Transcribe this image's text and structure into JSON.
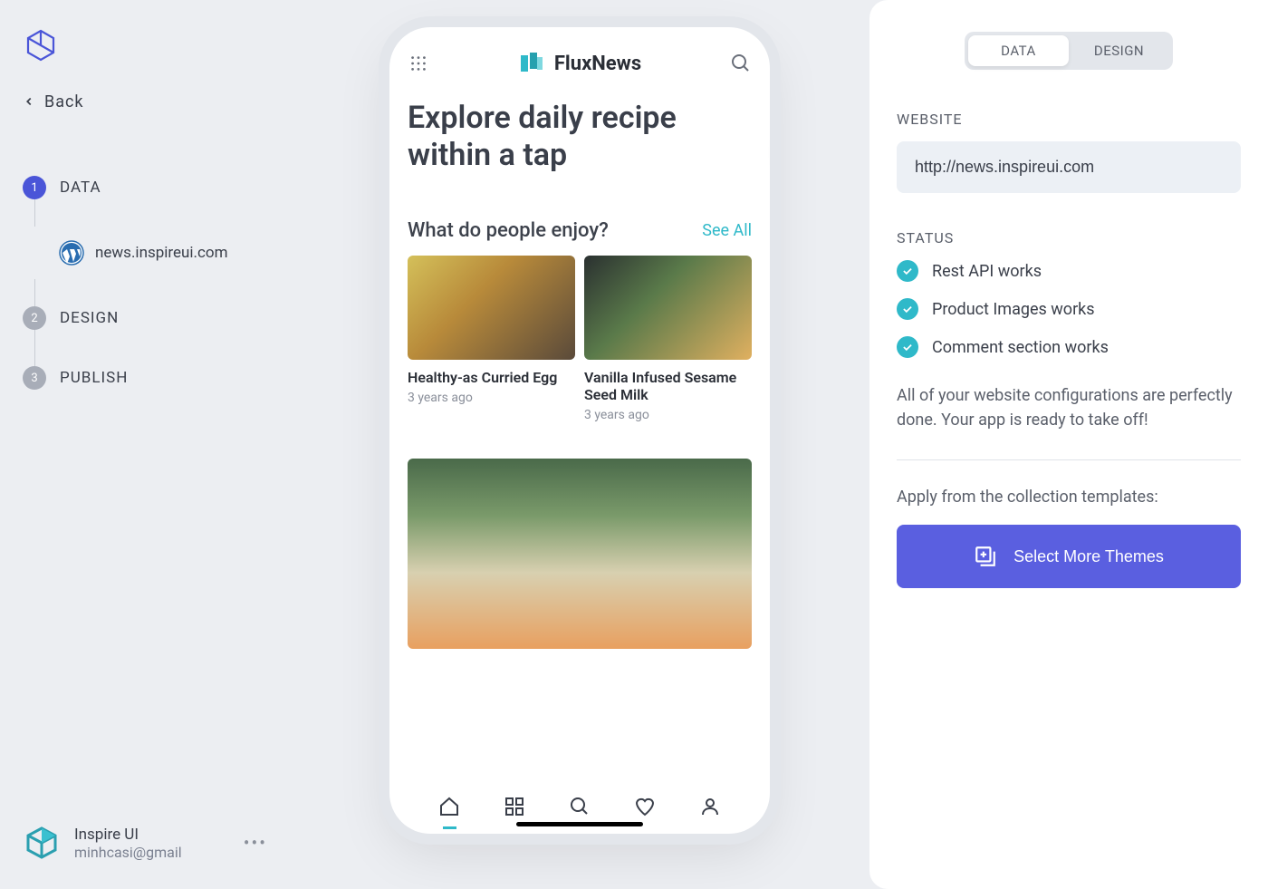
{
  "sidebar": {
    "back_label": "Back",
    "steps": [
      {
        "num": "1",
        "label": "DATA",
        "active": true
      },
      {
        "num": "2",
        "label": "DESIGN",
        "active": false
      },
      {
        "num": "3",
        "label": "PUBLISH",
        "active": false
      }
    ],
    "substep_site": "news.inspireui.com",
    "footer_name": "Inspire UI",
    "footer_email": "minhcasi@gmail"
  },
  "phone": {
    "brand": "FluxNews",
    "hero_title": "Explore daily recipe within a tap",
    "section_title": "What do people enjoy?",
    "see_all": "See All",
    "cards": [
      {
        "title": "Healthy-as Curried Egg",
        "meta": "3 years ago"
      },
      {
        "title": "Vanilla Infused Sesame Seed Milk",
        "meta": "3 years ago"
      }
    ],
    "nav_icons": [
      "home-icon",
      "grid-icon",
      "search-icon",
      "heart-icon",
      "user-icon"
    ]
  },
  "right": {
    "tabs": {
      "data": "DATA",
      "design": "DESIGN"
    },
    "website_label": "WEBSITE",
    "website_url": "http://news.inspireui.com",
    "status_label": "STATUS",
    "status_items": [
      "Rest API works",
      "Product Images works",
      "Comment section works"
    ],
    "status_msg": "All of your website configurations are perfectly done. Your app is ready to take off!",
    "apply_text": "Apply from the collection templates:",
    "select_themes": "Select More Themes"
  }
}
